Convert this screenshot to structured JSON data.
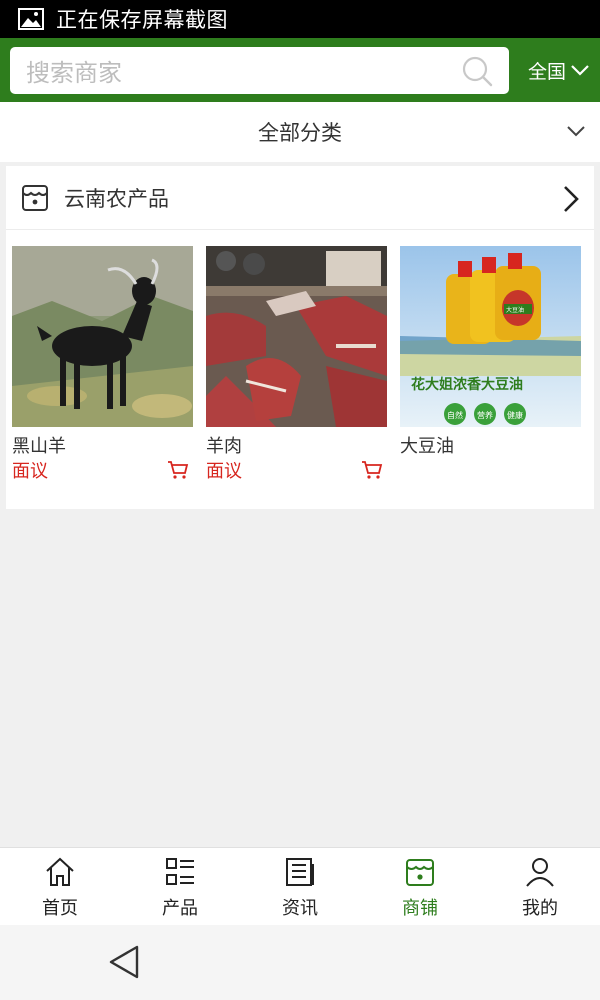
{
  "status_bar": {
    "text": "正在保存屏幕截图",
    "icon": "image-icon"
  },
  "header": {
    "search": {
      "placeholder": "搜索商家",
      "icon": "search-icon"
    },
    "region": {
      "label": "全国",
      "icon": "chevron-down-icon"
    },
    "brand_color": "#2e7d1d"
  },
  "category_bar": {
    "label": "全部分类",
    "icon": "chevron-down-icon"
  },
  "shop": {
    "name": "云南农产品",
    "icon": "store-icon",
    "arrow_icon": "chevron-right-icon",
    "products": [
      {
        "name": "黑山羊",
        "price": "面议",
        "has_cart": true,
        "image": "black-goat-photo"
      },
      {
        "name": "羊肉",
        "price": "面议",
        "has_cart": true,
        "image": "mutton-photo"
      },
      {
        "name": "大豆油",
        "price": "",
        "has_cart": false,
        "image": "soybean-oil-photo",
        "image_text": {
          "headline": "花大姐浓香大豆油",
          "badges": [
            "自然",
            "营养",
            "健康"
          ],
          "bottle_label": "大豆油"
        }
      }
    ]
  },
  "bottom_nav": {
    "items": [
      {
        "label": "首页",
        "icon": "home-icon",
        "active": false
      },
      {
        "label": "产品",
        "icon": "list-icon",
        "active": false
      },
      {
        "label": "资讯",
        "icon": "news-icon",
        "active": false
      },
      {
        "label": "商铺",
        "icon": "store-icon",
        "active": true
      },
      {
        "label": "我的",
        "icon": "user-icon",
        "active": false
      }
    ]
  },
  "colors": {
    "accent": "#2e7d1d",
    "price": "#d7261f"
  }
}
